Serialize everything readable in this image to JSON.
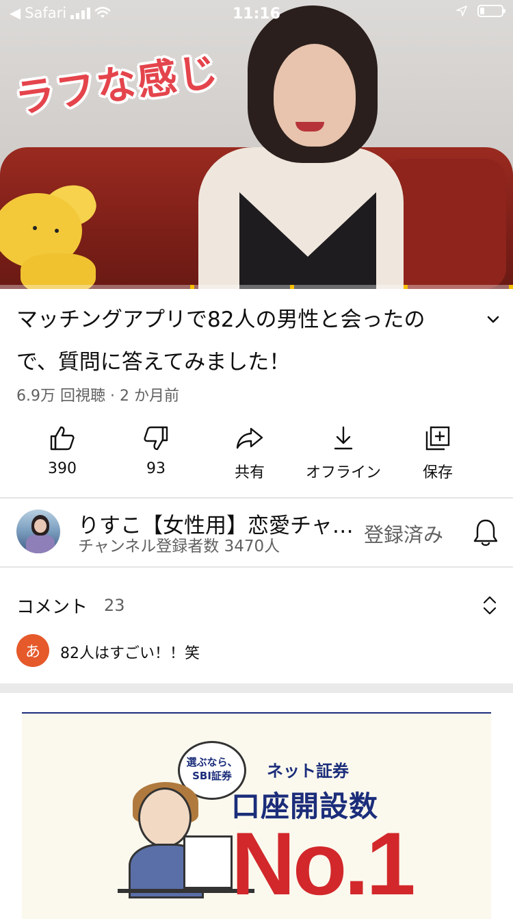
{
  "status_bar": {
    "back_app": "Safari",
    "time": "11:16",
    "battery_level": 0.2
  },
  "video": {
    "caption": "ラフな感じ"
  },
  "title": "マッチングアプリで82人の男性と会ったので、質問に答えてみました！",
  "meta": "6.9万 回視聴 · 2 か月前",
  "actions": {
    "like": "390",
    "dislike": "93",
    "share": "共有",
    "offline": "オフライン",
    "save": "保存"
  },
  "channel": {
    "name": "りすこ【女性用】恋愛チャンネル",
    "subscribers": "チャンネル登録者数 3470人",
    "subscribe_state": "登録済み"
  },
  "comments": {
    "label": "コメント",
    "count": "23",
    "top_avatar": "あ",
    "top_comment": "82人はすごい！！笑"
  },
  "ad": {
    "bubble_line1": "選ぶなら、",
    "bubble_line2": "SBI証券",
    "brand": "ネット証券",
    "headline": "口座開設数",
    "big": "No.1"
  },
  "colors": {
    "accent_red": "#e4444c",
    "ad_navy": "#1b2d7a",
    "ad_red": "#d2282b",
    "comment_avatar": "#e5592b"
  }
}
